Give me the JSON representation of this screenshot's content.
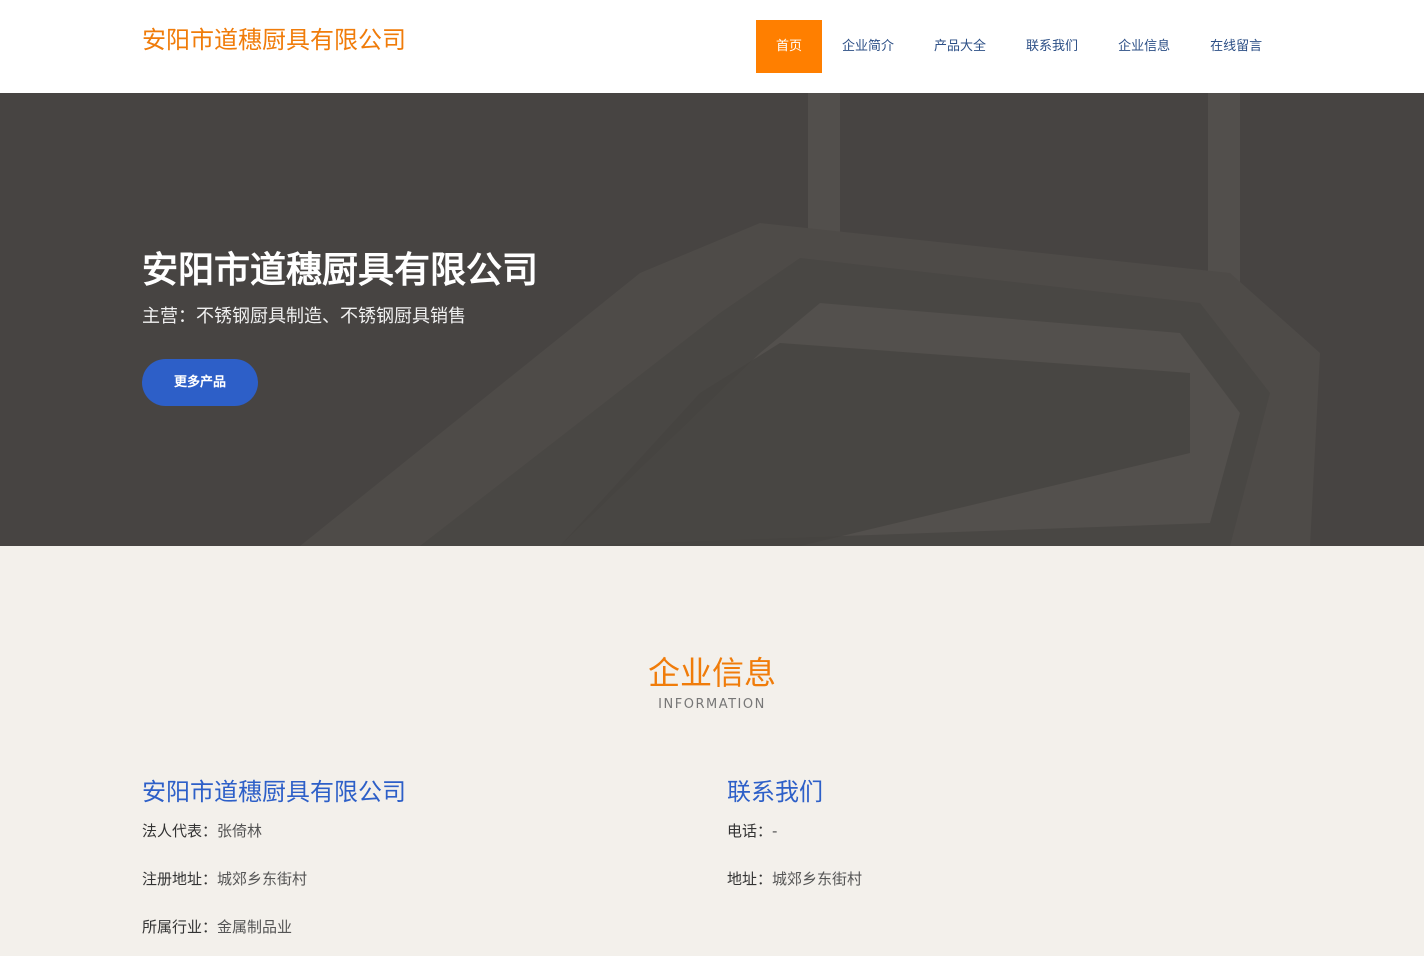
{
  "header": {
    "logo": "安阳市道穗厨具有限公司",
    "nav": [
      {
        "label": "首页",
        "active": true
      },
      {
        "label": "企业简介",
        "active": false
      },
      {
        "label": "产品大全",
        "active": false
      },
      {
        "label": "联系我们",
        "active": false
      },
      {
        "label": "企业信息",
        "active": false
      },
      {
        "label": "在线留言",
        "active": false
      }
    ]
  },
  "hero": {
    "title": "安阳市道穗厨具有限公司",
    "subtitle": "主营：不锈钢厨具制造、不锈钢厨具销售",
    "button": "更多产品"
  },
  "info": {
    "title": "企业信息",
    "subtitle": "INFORMATION",
    "company": {
      "name": "安阳市道穗厨具有限公司",
      "rows": [
        {
          "label": "法人代表：",
          "value": "张倚林"
        },
        {
          "label": "注册地址：",
          "value": "城郊乡东街村"
        },
        {
          "label": "所属行业：",
          "value": "金属制品业"
        }
      ]
    },
    "contact": {
      "title": "联系我们",
      "rows": [
        {
          "label": "电话：",
          "value": "-"
        },
        {
          "label": "地址：",
          "value": "城郊乡东街村"
        }
      ]
    }
  },
  "colors": {
    "brand_orange": "#f07c0a",
    "nav_active": "#ff7f00",
    "button_blue": "#2d5fc8",
    "page_bg": "#f3f0eb"
  }
}
